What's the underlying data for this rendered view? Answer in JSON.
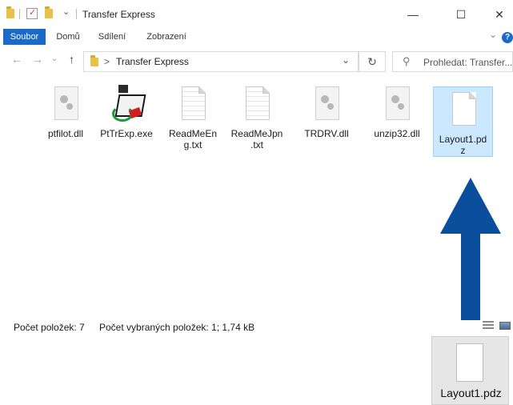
{
  "window": {
    "title": "Transfer Express",
    "controls": {
      "minimize": "—",
      "maximize": "☐",
      "close": "✕"
    }
  },
  "ribbon": {
    "tabs": [
      {
        "label": "Soubor",
        "active": true
      },
      {
        "label": "Domů"
      },
      {
        "label": "Sdílení"
      },
      {
        "label": "Zobrazení"
      }
    ],
    "expand": "⌄",
    "help": "?"
  },
  "address": {
    "path_separator": ">",
    "path": "Transfer Express",
    "dropdown": "⌄",
    "refresh": "↻",
    "search_icon": "⚲",
    "search_placeholder": "Prohledat: Transfer..."
  },
  "nav": {
    "back": "←",
    "forward": "→",
    "recent": "⌄",
    "up": "↑"
  },
  "files": [
    {
      "name": "ptfilot.dll",
      "icon": "dll-gear-icon"
    },
    {
      "name": "PtTrExp.exe",
      "icon": "printer-exe-icon"
    },
    {
      "name": "ReadMeEng.txt",
      "icon": "text-file-icon",
      "line1": "ReadMeEn",
      "line2": "g.txt"
    },
    {
      "name": "ReadMeJpn.txt",
      "icon": "text-file-icon",
      "line1": "ReadMeJpn",
      "line2": ".txt"
    },
    {
      "name": "TRDRV.dll",
      "icon": "dll-gear-icon"
    },
    {
      "name": "unzip32.dll",
      "icon": "dll-gear-icon"
    },
    {
      "name": "Layout1.pdz",
      "icon": "blank-file-icon",
      "line1": "Layout1.pd",
      "line2": "z",
      "selected": true
    }
  ],
  "status": {
    "count": "Počet položek: 7",
    "selected": "Počet vybraných položek: 1; 1,74 kB"
  },
  "drag_preview": {
    "label": "Layout1.pdz"
  },
  "colors": {
    "accent": "#1a6bc7",
    "arrow": "#0b4f9c",
    "selection": "#cce8ff"
  }
}
